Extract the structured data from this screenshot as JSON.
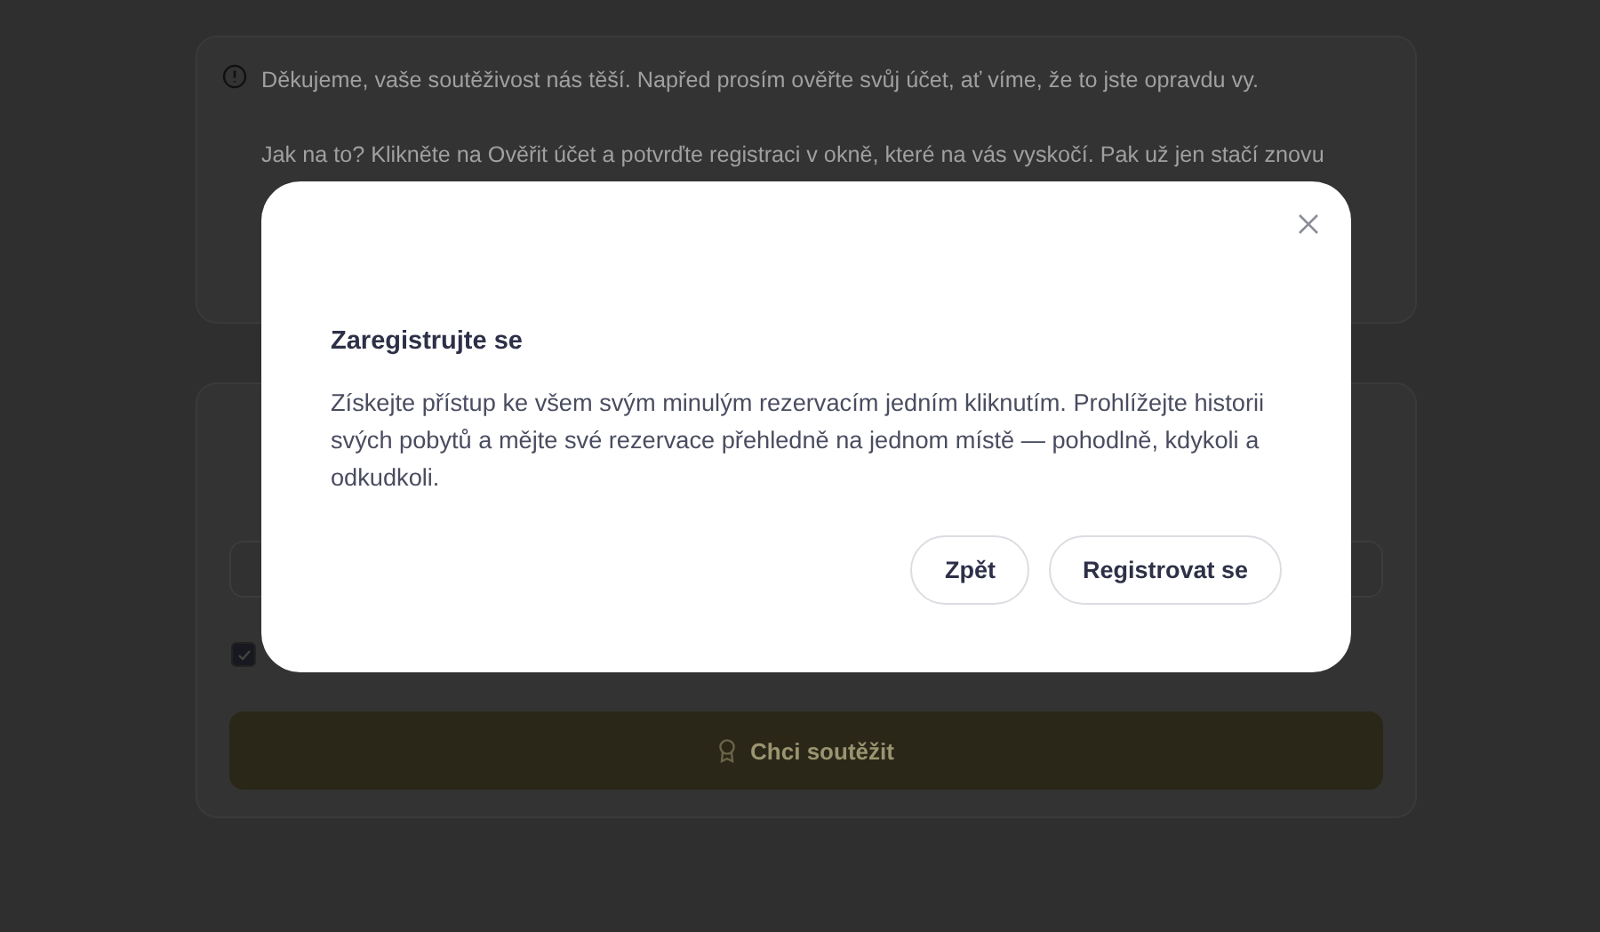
{
  "notice": {
    "lines": [
      "Děkujeme, vaše soutěživost nás těší. Napřed prosím ověřte svůj účet, ať víme, že to jste opravdu vy.",
      "Jak na to? Klikněte na Ověřit účet a potvrďte registraci v okně, které na vás vyskočí. Pak už jen stačí znovu"
    ]
  },
  "form": {
    "consent_checked": true,
    "submit_button": "Chci soutěžit"
  },
  "dialog": {
    "title": "Zaregistrujte se",
    "body": "Získejte přístup ke všem svým minulým rezervacím jedním kliknutím. Prohlížejte historii svých pobytů a mějte své rezervace přehledně na jednom místě — pohodlně, kdykoli a odkudkoli.",
    "buttons": [
      "Zpět",
      "Registrovat se"
    ]
  }
}
